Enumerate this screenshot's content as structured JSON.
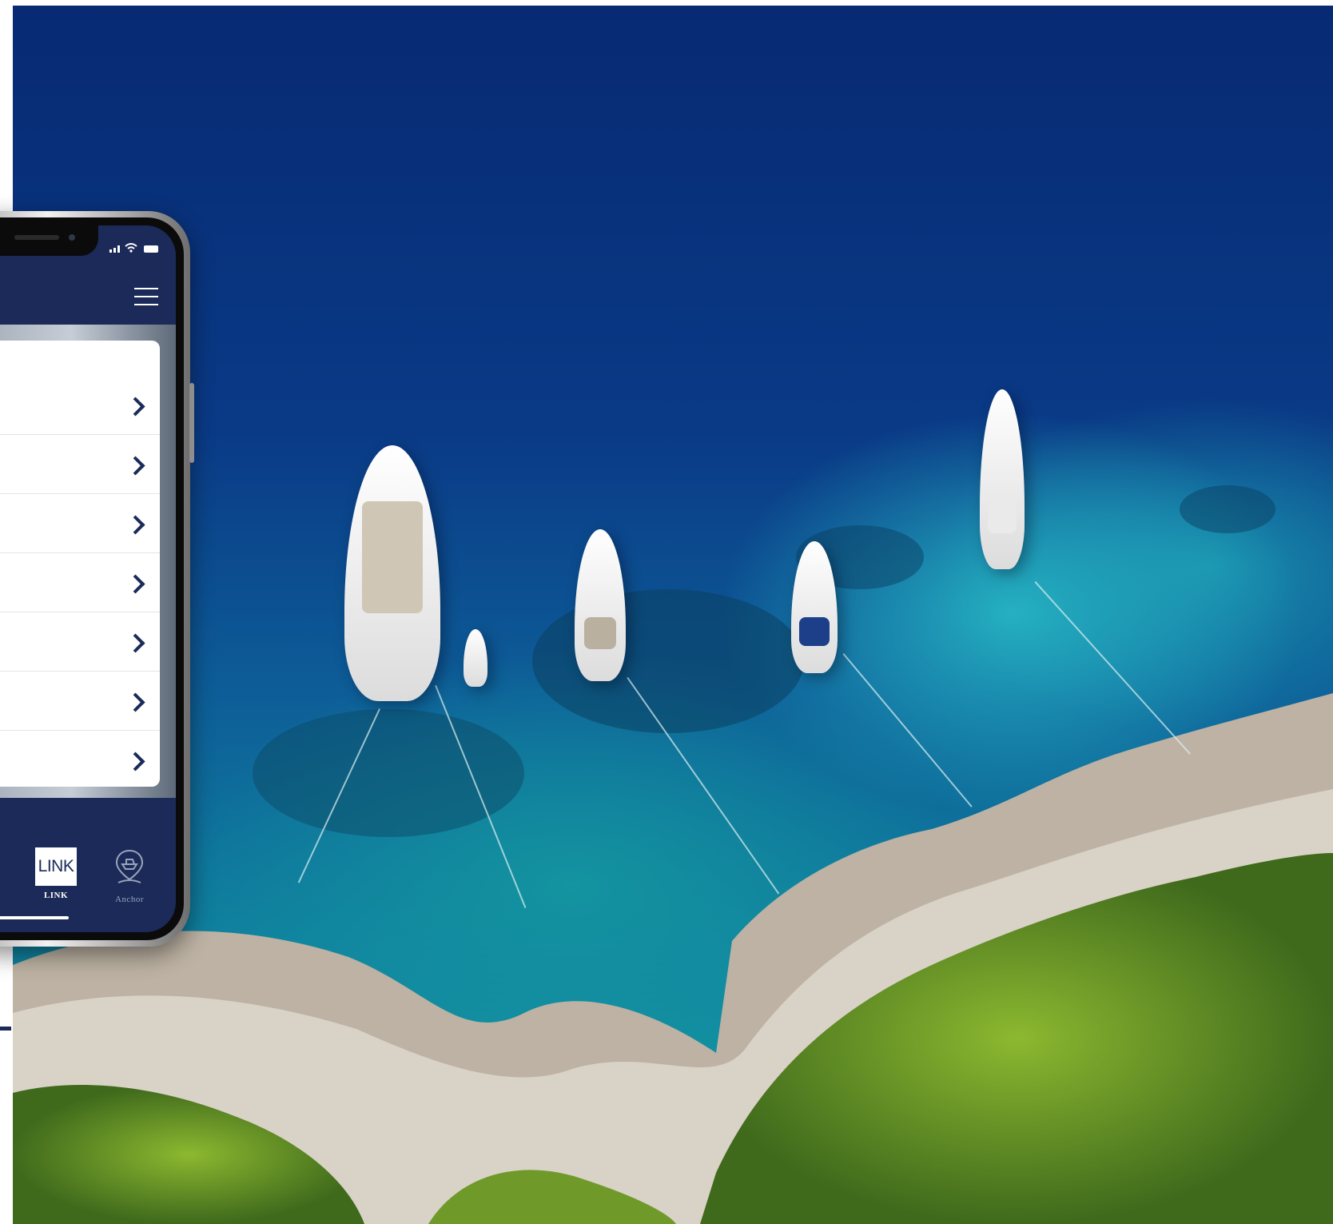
{
  "phone": {
    "menu_items": [
      {
        "label": ""
      },
      {
        "label": ""
      },
      {
        "label": ""
      },
      {
        "label": ""
      },
      {
        "label": ""
      },
      {
        "label": ""
      },
      {
        "label": ""
      }
    ],
    "tabs": [
      {
        "name": "link",
        "icon_text": "LINK",
        "label": "LINK",
        "active": true
      },
      {
        "name": "anchor",
        "icon": "anchor-boat-pin-icon",
        "label": "Anchor",
        "active": false
      }
    ]
  },
  "colors": {
    "app_navy": "#1b2a59",
    "chevron": "#1b2a59",
    "sea_deep": "#072a73",
    "sea_shallow": "#16a0a6"
  }
}
